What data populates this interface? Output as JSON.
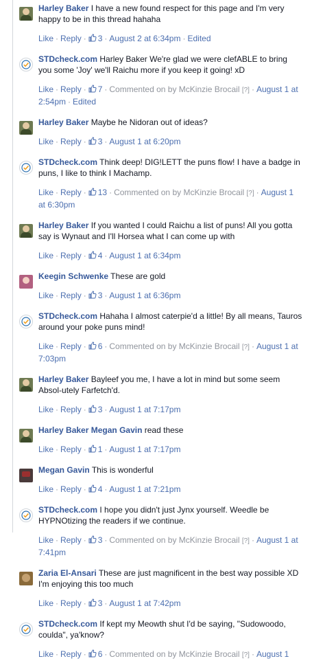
{
  "labels": {
    "like": "Like",
    "reply": "Reply",
    "edited": "Edited",
    "commented_on_by": "Commented on by",
    "help": "[?]"
  },
  "comments": [
    {
      "author": "Harley Baker",
      "avatar": "avatar-harley",
      "text": "I have a new found respect for this page and I'm very happy to be in this thread hahaha",
      "likes": "3",
      "time": "August 2 at 6:34pm",
      "edited": true,
      "manager": ""
    },
    {
      "author": "STDcheck.com",
      "avatar": "avatar-stdcheck",
      "text": "Harley Baker We're glad we were clefABLE to bring you some 'Joy' we'll Raichu more if you keep it going! xD",
      "likes": "7",
      "time": "August 1 at 2:54pm",
      "edited": true,
      "manager": "McKinzie Brocail"
    },
    {
      "author": "Harley Baker",
      "avatar": "avatar-harley",
      "text": "Maybe he Nidoran out of ideas?",
      "likes": "3",
      "time": "August 1 at 6:20pm",
      "edited": false,
      "manager": ""
    },
    {
      "author": "STDcheck.com",
      "avatar": "avatar-stdcheck",
      "text": "Think deep! DIG!LETT the puns flow! I have a badge in puns, I like to think I Machamp.",
      "likes": "13",
      "time": "August 1 at 6:30pm",
      "edited": false,
      "manager": "McKinzie Brocail"
    },
    {
      "author": "Harley Baker",
      "avatar": "avatar-harley",
      "text": "If you wanted I could Raichu a list of puns! All you gotta say is Wynaut and I'll Horsea what I can come up with",
      "likes": "4",
      "time": "August 1 at 6:34pm",
      "edited": false,
      "manager": ""
    },
    {
      "author": "Keegin Schwenke",
      "avatar": "avatar-keegin",
      "text": "These are gold",
      "likes": "3",
      "time": "August 1 at 6:36pm",
      "edited": false,
      "manager": ""
    },
    {
      "author": "STDcheck.com",
      "avatar": "avatar-stdcheck",
      "text": "Hahaha I almost caterpie'd a little! By all means, Tauros around your poke puns mind!",
      "likes": "6",
      "time": "August 1 at 7:03pm",
      "edited": false,
      "manager": "McKinzie Brocail"
    },
    {
      "author": "Harley Baker",
      "avatar": "avatar-harley",
      "text": "Bayleef you me, I have a lot in mind but some seem Absol-utely Farfetch'd.",
      "likes": "3",
      "time": "August 1 at 7:17pm",
      "edited": false,
      "manager": ""
    },
    {
      "author": "Harley Baker",
      "avatar": "avatar-harley",
      "tagged": "Megan Gavin",
      "text": "read these",
      "likes": "1",
      "time": "August 1 at 7:17pm",
      "edited": false,
      "manager": ""
    },
    {
      "author": "Megan Gavin",
      "avatar": "avatar-megan",
      "text": "This is wonderful",
      "likes": "4",
      "time": "August 1 at 7:21pm",
      "edited": false,
      "manager": ""
    },
    {
      "author": "STDcheck.com",
      "avatar": "avatar-stdcheck",
      "text": "I hope you didn't just Jynx yourself. Weedle be HYPNOtizing the readers if we continue.",
      "likes": "3",
      "time": "August 1 at 7:41pm",
      "edited": false,
      "manager": "McKinzie Brocail"
    },
    {
      "author": "Zaria El-Ansari",
      "avatar": "avatar-zaria",
      "text": "These are just magnificent in the best way possible XD I'm enjoying this too much",
      "likes": "3",
      "time": "August 1 at 7:42pm",
      "edited": false,
      "manager": ""
    },
    {
      "author": "STDcheck.com",
      "avatar": "avatar-stdcheck",
      "text": "If kept my Meowth shut I'd be saying, \"Sudowoodo, coulda\", ya'know?",
      "likes": "6",
      "time": "August 1",
      "edited": false,
      "manager": "McKinzie Brocail"
    }
  ]
}
